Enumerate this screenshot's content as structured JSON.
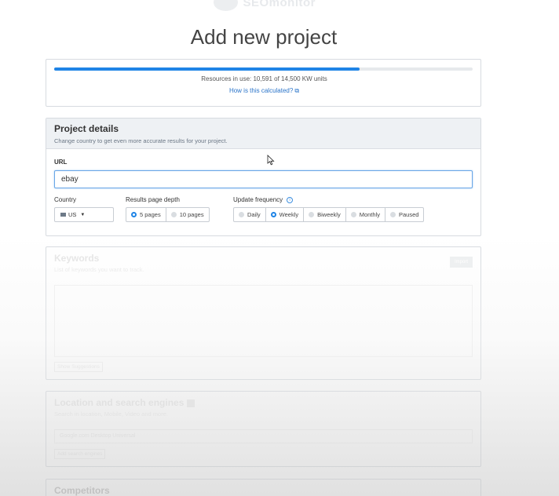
{
  "header": {
    "logo_text": "SEOmonitor",
    "title": "Add new project"
  },
  "usage": {
    "progress_fraction": 0.73,
    "resources_text": "Resources in use: 10,591 of 14,500 KW units",
    "how_link": "How is this calculated?"
  },
  "project_details": {
    "title": "Project details",
    "subtitle": "Change country to get even more accurate results for your project.",
    "url_label": "URL",
    "url_value": "ebay",
    "country_label": "Country",
    "country_value": "US",
    "depth_label": "Results page depth",
    "depth_options": [
      "5 pages",
      "10 pages"
    ],
    "depth_selected": "5 pages",
    "frequency_label": "Update frequency",
    "frequency_options": [
      "Daily",
      "Weekly",
      "Biweekly",
      "Monthly",
      "Paused"
    ],
    "frequency_selected": "Weekly"
  },
  "keywords": {
    "title": "Keywords",
    "subtitle": "List of keywords you want to track.",
    "import_label": "Import",
    "suggestions_label": "Show Suggestions"
  },
  "location": {
    "title": "Location and search engines",
    "subtitle": "Search in location, Mobile, Video and more.",
    "engine_value": "Google.com Desktop Universal",
    "add_label": "Add search engines"
  },
  "competitors": {
    "title": "Competitors"
  },
  "colors": {
    "accent": "#1f84e6",
    "link": "#2a74c9",
    "panel_head": "#eef1f4"
  }
}
